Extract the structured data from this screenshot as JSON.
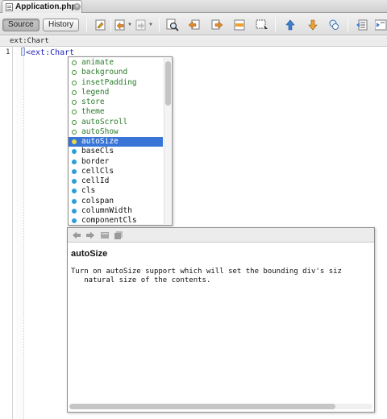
{
  "tab": {
    "title": "Application.php",
    "close_glyph": "✕"
  },
  "toolbar": {
    "source_label": "Source",
    "history_label": "History",
    "icons": [
      "last-edit-icon",
      "back-icon",
      "forward-icon",
      "find-icon",
      "find-previous-icon",
      "find-next-icon",
      "highlight-icon",
      "toggle-bookmark-icon",
      "previous-bookmark-icon",
      "next-bookmark-icon",
      "toggle-comment-icon",
      "shift-left-icon"
    ]
  },
  "breadcrumb": {
    "text": "ext:Chart"
  },
  "editor": {
    "line_number": "1",
    "code": "<ext:Chart"
  },
  "completion": {
    "items": [
      {
        "label": "animate",
        "kind": "required"
      },
      {
        "label": "background",
        "kind": "required"
      },
      {
        "label": "insetPadding",
        "kind": "required"
      },
      {
        "label": "legend",
        "kind": "required"
      },
      {
        "label": "store",
        "kind": "required"
      },
      {
        "label": "theme",
        "kind": "required"
      },
      {
        "label": "autoScroll",
        "kind": "required"
      },
      {
        "label": "autoShow",
        "kind": "required"
      },
      {
        "label": "autoSize",
        "kind": "selected"
      },
      {
        "label": "baseCls",
        "kind": "optional"
      },
      {
        "label": "border",
        "kind": "optional"
      },
      {
        "label": "cellCls",
        "kind": "optional"
      },
      {
        "label": "cellId",
        "kind": "optional"
      },
      {
        "label": "cls",
        "kind": "optional"
      },
      {
        "label": "colspan",
        "kind": "optional"
      },
      {
        "label": "columnWidth",
        "kind": "optional"
      },
      {
        "label": "componentCls",
        "kind": "optional"
      }
    ]
  },
  "documentation": {
    "title": "autoSize",
    "text": "Turn on autoSize support which will set the bounding div's siz\n   natural size of the contents."
  },
  "colors": {
    "selection": "#3875d7",
    "keyword_green": "#2b7a2b",
    "tag_blue": "#2222bb"
  }
}
